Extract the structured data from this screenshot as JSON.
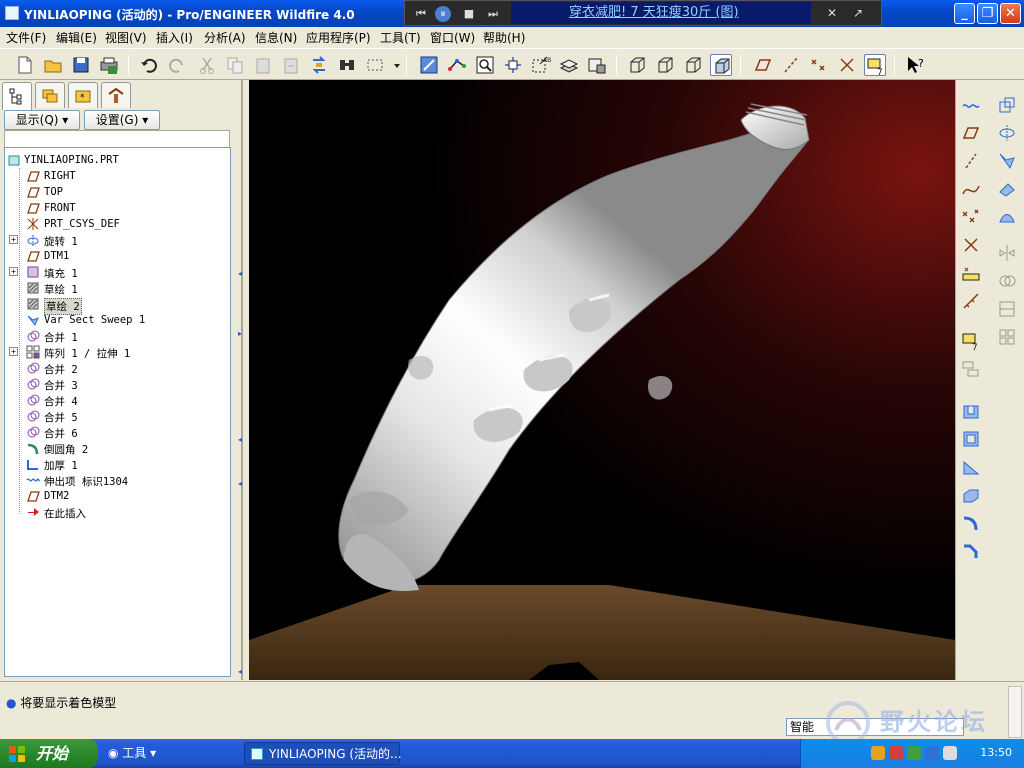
{
  "window": {
    "title": "YINLIAOPING (活动的) - Pro/ENGINEER Wildfire 4.0",
    "min": "_",
    "max": "❐",
    "close": "✕"
  },
  "mediabar": {
    "text": "穿衣减肥! 7 天狂瘦30斤 (图)",
    "prev": "⏮",
    "play": "⏸",
    "stop": "■",
    "next": "⏭",
    "small1": "✕",
    "small2": "↗"
  },
  "menu": [
    "文件(F)",
    "编辑(E)",
    "视图(V)",
    "插入(I)",
    "分析(A)",
    "信息(N)",
    "应用程序(P)",
    "工具(T)",
    "窗口(W)",
    "帮助(H)"
  ],
  "panel": {
    "show_label": "显示(Q) ▾",
    "settings_label": "设置(G) ▾"
  },
  "tree": [
    {
      "label": "YINLIAOPING.PRT",
      "icon": "part-icon",
      "root": true
    },
    {
      "label": "RIGHT",
      "icon": "datum-plane-icon"
    },
    {
      "label": "TOP",
      "icon": "datum-plane-icon"
    },
    {
      "label": "FRONT",
      "icon": "datum-plane-icon"
    },
    {
      "label": "PRT_CSYS_DEF",
      "icon": "csys-icon"
    },
    {
      "label": "旋转 1",
      "icon": "revolve-icon",
      "expand": true
    },
    {
      "label": "DTM1",
      "icon": "datum-plane-icon"
    },
    {
      "label": "填充 1",
      "icon": "fill-icon",
      "expand": true
    },
    {
      "label": "草绘 1",
      "icon": "sketch-icon"
    },
    {
      "label": "草绘 2",
      "icon": "sketch-icon",
      "highlight": true
    },
    {
      "label": "Var Sect Sweep 1",
      "icon": "sweep-icon"
    },
    {
      "label": "合并 1",
      "icon": "merge-icon"
    },
    {
      "label": "阵列 1 / 拉伸 1",
      "icon": "pattern-icon",
      "expand": true
    },
    {
      "label": "合并 2",
      "icon": "merge-icon"
    },
    {
      "label": "合并 3",
      "icon": "merge-icon"
    },
    {
      "label": "合并 4",
      "icon": "merge-icon"
    },
    {
      "label": "合并 5",
      "icon": "merge-icon"
    },
    {
      "label": "合并 6",
      "icon": "merge-icon"
    },
    {
      "label": "倒圆角 2",
      "icon": "round-icon"
    },
    {
      "label": "加厚 1",
      "icon": "thicken-icon"
    },
    {
      "label": "伸出项 标识1304",
      "icon": "protrusion-icon"
    },
    {
      "label": "DTM2",
      "icon": "datum-plane-icon"
    },
    {
      "label": "在此插入",
      "icon": "insert-here-arrow-icon"
    }
  ],
  "message": "将要显示着色模型",
  "filter": {
    "value": "智能"
  },
  "watermark": "野火论坛",
  "taskbar": {
    "start": "开始",
    "tools": "工具",
    "window_task": "YINLIAOPING (活动的...",
    "clock": "13:50"
  }
}
